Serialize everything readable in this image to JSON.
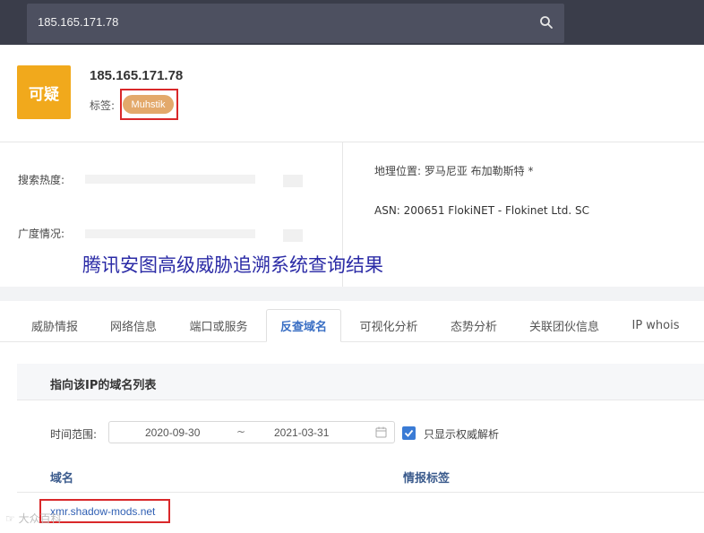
{
  "search": {
    "value": "185.165.171.78"
  },
  "header": {
    "verdict": "可疑",
    "ip": "185.165.171.78",
    "tag_label": "标签:",
    "tag": "Muhstik"
  },
  "stats": {
    "heat_label": "搜索热度:",
    "spread_label": "广度情况:",
    "geo": "地理位置:  罗马尼亚 布加勒斯特 *",
    "asn": "ASN:  200651 FlokiNET - Flokinet Ltd. SC"
  },
  "overlay_title": "腾讯安图高级威胁追溯系统查询结果",
  "tabs": [
    {
      "label": "威胁情报"
    },
    {
      "label": "网络信息"
    },
    {
      "label": "端口或服务"
    },
    {
      "label": "反查域名"
    },
    {
      "label": "可视化分析"
    },
    {
      "label": "态势分析"
    },
    {
      "label": "关联团伙信息"
    },
    {
      "label": "IP whois"
    }
  ],
  "active_tab": "反查域名",
  "panel": {
    "title": "指向该IP的域名列表",
    "time_label": "时间范围:",
    "date_from": "2020-09-30",
    "date_sep": "~",
    "date_to": "2021-03-31",
    "authoritative_only": true,
    "checkbox_label": "只显示权威解析",
    "columns": [
      "域名",
      "情报标签"
    ],
    "rows": [
      {
        "domain": "xmr.shadow-mods.net",
        "tag": ""
      }
    ]
  },
  "corner_mark": "☞ 大众百科",
  "colors": {
    "topbar": "#3a3d4a",
    "verdict_badge": "#f1a91c",
    "tag_pill": "#e3a96b",
    "highlight": "#d9282a",
    "link": "#2f5fb3",
    "overlay_text": "#2b2ba6"
  }
}
